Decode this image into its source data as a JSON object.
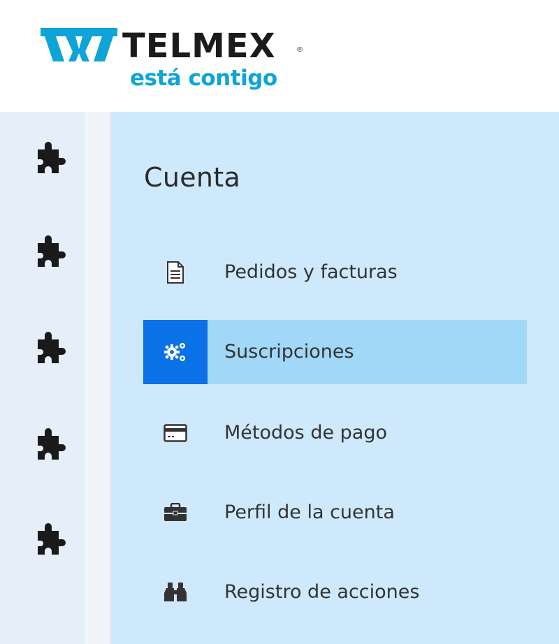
{
  "brand": {
    "name": "TELMEX",
    "registered": "®",
    "tagline": "está contigo",
    "colors": {
      "mark": "#0fa4d8",
      "name": "#1b1b1b",
      "tagline": "#0fa4d8"
    }
  },
  "rail": {
    "items": [
      {
        "icon": "puzzle-icon"
      },
      {
        "icon": "puzzle-icon"
      },
      {
        "icon": "puzzle-icon"
      },
      {
        "icon": "puzzle-icon"
      },
      {
        "icon": "puzzle-icon"
      }
    ]
  },
  "panel": {
    "title": "Cuenta",
    "menu": [
      {
        "label": "Pedidos y facturas",
        "icon": "document-icon",
        "active": false
      },
      {
        "label": "Suscripciones",
        "icon": "gears-icon",
        "active": true
      },
      {
        "label": "Métodos de pago",
        "icon": "credit-card-icon",
        "active": false
      },
      {
        "label": "Perfil de la cuenta",
        "icon": "briefcase-icon",
        "active": false
      },
      {
        "label": "Registro de acciones",
        "icon": "binoculars-icon",
        "active": false
      }
    ]
  },
  "colors": {
    "panel_bg": "#cfe9fc",
    "active_row": "#a2d8f7",
    "active_icon_bg": "#0a72e6",
    "rail_bg": "#e8f1fb"
  }
}
